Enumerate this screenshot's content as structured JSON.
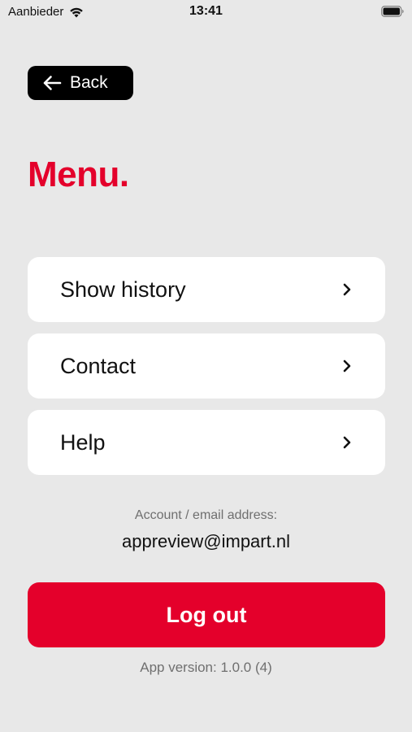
{
  "status_bar": {
    "carrier": "Aanbieder",
    "time": "13:41"
  },
  "header": {
    "back_label": "Back",
    "title": "Menu."
  },
  "menu": {
    "items": [
      {
        "label": "Show history",
        "icon": "chevron-right-icon"
      },
      {
        "label": "Contact",
        "icon": "chevron-right-icon"
      },
      {
        "label": "Help",
        "icon": "chevron-right-icon"
      }
    ]
  },
  "account": {
    "caption": "Account / email address:",
    "email": "appreview@impart.nl"
  },
  "logout": {
    "label": "Log out"
  },
  "footer": {
    "version": "App version: 1.0.0 (4)"
  },
  "colors": {
    "accent": "#e4002b",
    "background": "#e8e8e8",
    "card": "#ffffff",
    "back_button": "#000000"
  }
}
